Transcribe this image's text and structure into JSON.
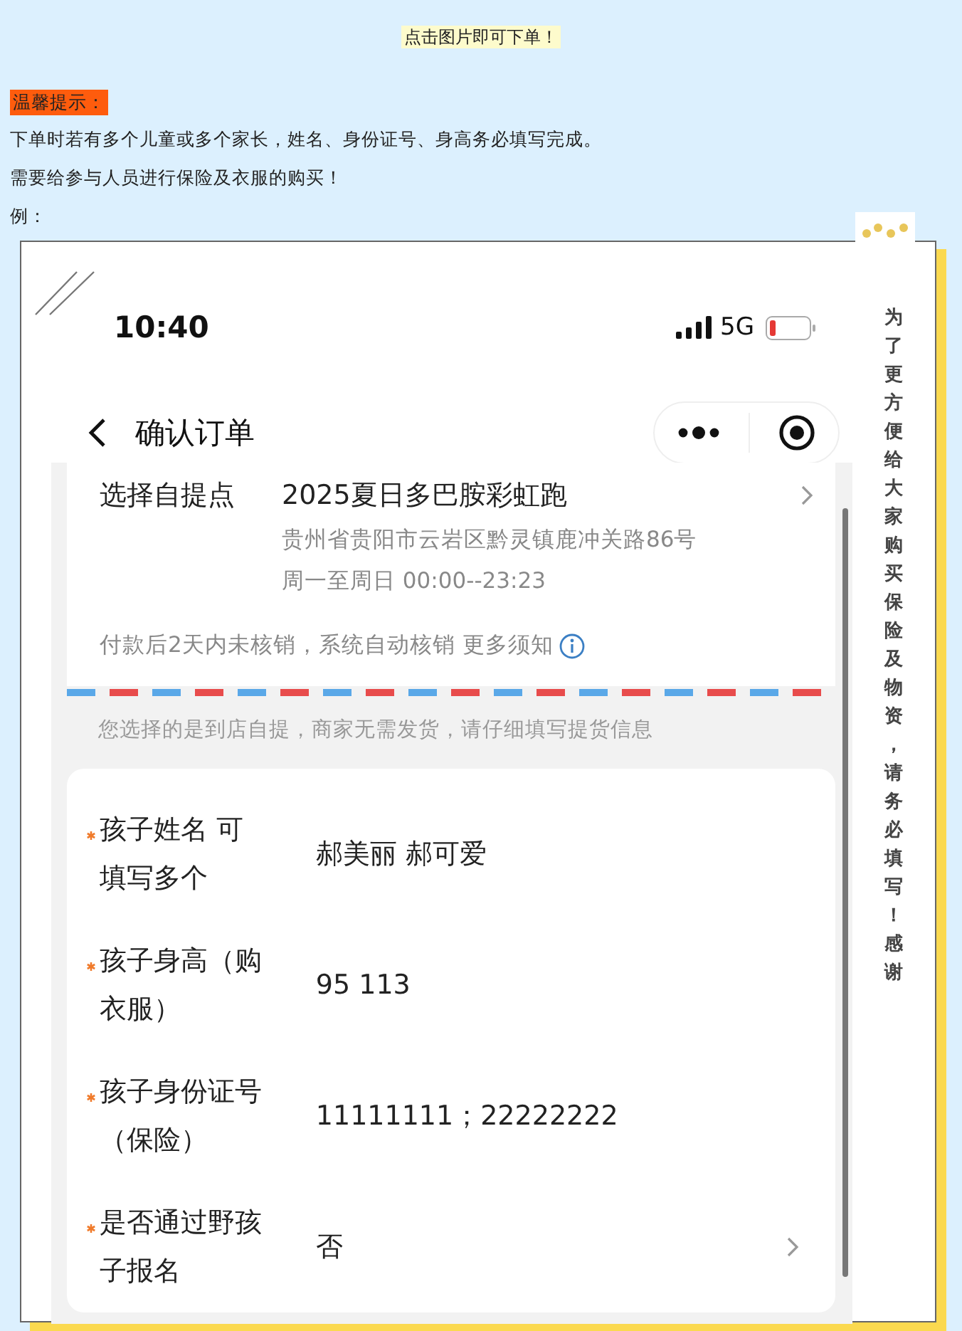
{
  "banner": "点击图片即可下单！",
  "notice": {
    "title": "温馨提示：",
    "lines": [
      "下单时若有多个儿童或多个家长，姓名、身份证号、身高务必填写完成。",
      "需要给参与人员进行保险及衣服的购买！",
      "例："
    ]
  },
  "screenshot": {
    "status": {
      "time": "10:40",
      "network": "5G"
    },
    "nav": {
      "title": "确认订单"
    },
    "pickup": {
      "label": "选择自提点",
      "name": "2025夏日多巴胺彩虹跑",
      "address": "贵州省贵阳市云岩区黔灵镇鹿冲关路86号",
      "hours": "周一至周日 00:00--23:23",
      "notice": "付款后2天内未核销，系统自动核销 更多须知"
    },
    "delivery_note": "您选择的是到店自提，商家无需发货，请仔细填写提货信息",
    "form": [
      {
        "label": "孩子姓名 可填写多个",
        "value": "郝美丽 郝可爱",
        "required": true,
        "has_arrow": false
      },
      {
        "label": "孩子身高（购衣服）",
        "value": "95 113",
        "required": true,
        "has_arrow": false
      },
      {
        "label": "孩子身份证号（保险）",
        "value": "11111111；22222222",
        "required": true,
        "has_arrow": false
      },
      {
        "label": "是否通过野孩子报名",
        "value": "否",
        "required": true,
        "has_arrow": true
      }
    ]
  },
  "side_note": "为了更方便给大家购买保险及物资，请务必填写！感谢"
}
